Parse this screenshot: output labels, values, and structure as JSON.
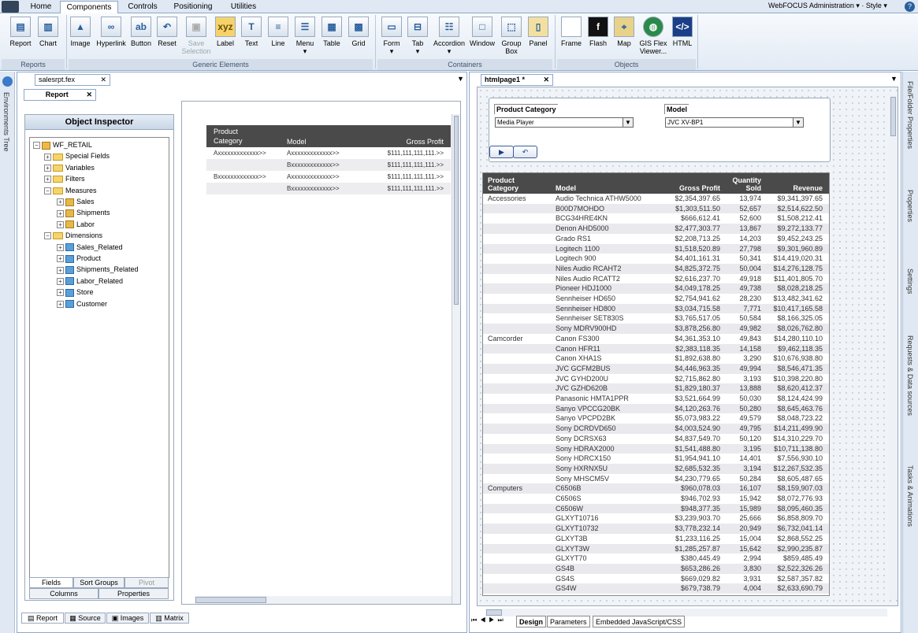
{
  "app": {
    "admin_label": "WebFOCUS Administration",
    "style_label": "Style",
    "help_label": "?"
  },
  "ribbon_tabs": [
    "Home",
    "Components",
    "Controls",
    "Positioning",
    "Utilities"
  ],
  "ribbon": {
    "reports": {
      "group": "Reports",
      "items": [
        "Report",
        "Chart"
      ]
    },
    "generic": {
      "group": "Generic Elements",
      "items": [
        "Image",
        "Hyperlink",
        "Button",
        "Reset",
        "Save Selection",
        "Label",
        "Text",
        "Line",
        "Menu",
        "Table",
        "Grid"
      ]
    },
    "containers": {
      "group": "Containers",
      "items": [
        "Form",
        "Tab",
        "Accordion",
        "Window",
        "Group Box",
        "Panel"
      ]
    },
    "objects": {
      "group": "Objects",
      "items": [
        "Frame",
        "Flash",
        "Map",
        "GIS Flex Viewer...",
        "HTML"
      ]
    }
  },
  "left_doc_tab": "salesrpt.fex",
  "left_sub_tab": "Report",
  "right_doc_tab": "htmlpage1 *",
  "object_inspector": {
    "title": "Object Inspector",
    "root": "WF_RETAIL",
    "nodes": [
      "Special Fields",
      "Variables",
      "Filters",
      "Measures",
      "Sales",
      "Shipments",
      "Labor",
      "Dimensions",
      "Sales_Related",
      "Product",
      "Shipments_Related",
      "Labor_Related",
      "Store",
      "Customer"
    ],
    "tabs_row1": [
      "Fields",
      "Sort Groups",
      "Pivot"
    ],
    "tabs_row2": [
      "Columns",
      "Properties"
    ]
  },
  "report_preview": {
    "headers": [
      "Product Category",
      "Model",
      "Gross Profit"
    ],
    "rows": [
      [
        "Axxxxxxxxxxxxx>>",
        "Axxxxxxxxxxxxx>>",
        "$111,111,111,111.>>"
      ],
      [
        "",
        "Bxxxxxxxxxxxxx>>",
        "$111,111,111,111.>>"
      ],
      [
        "Bxxxxxxxxxxxxx>>",
        "Axxxxxxxxxxxxx>>",
        "$111,111,111,111.>>"
      ],
      [
        "",
        "Bxxxxxxxxxxxxx>>",
        "$111,111,111,111.>>"
      ]
    ]
  },
  "left_bottom_tabs": [
    "Report",
    "Source",
    "Images",
    "Matrix"
  ],
  "form": {
    "category_label": "Product Category",
    "category_value": "Media Player",
    "model_label": "Model",
    "model_value": "JVC XV-BP1",
    "run_icon": "▶",
    "reset_icon": "↶"
  },
  "table": {
    "headers": [
      "Product Category",
      "Model",
      "Gross Profit",
      "Quantity Sold",
      "Revenue"
    ],
    "rows": [
      [
        "Accessories",
        "Audio Technica ATHW5000",
        "$2,354,397.65",
        "13,974",
        "$9,341,397.65"
      ],
      [
        "",
        "B00D7MOHDO",
        "$1,303,511.50",
        "52,657",
        "$2,514,622.50"
      ],
      [
        "",
        "BCG34HRE4KN",
        "$666,612.41",
        "52,600",
        "$1,508,212.41"
      ],
      [
        "",
        "Denon AHD5000",
        "$2,477,303.77",
        "13,867",
        "$9,272,133.77"
      ],
      [
        "",
        "Grado RS1",
        "$2,208,713.25",
        "14,203",
        "$9,452,243.25"
      ],
      [
        "",
        "Logitech 1100",
        "$1,518,520.89",
        "27,798",
        "$9,301,960.89"
      ],
      [
        "",
        "Logitech 900",
        "$4,401,161.31",
        "50,341",
        "$14,419,020.31"
      ],
      [
        "",
        "Niles Audio RCAHT2",
        "$4,825,372.75",
        "50,004",
        "$14,276,128.75"
      ],
      [
        "",
        "Niles Audio RCATT2",
        "$2,616,237.70",
        "49,918",
        "$11,401,805.70"
      ],
      [
        "",
        "Pioneer HDJ1000",
        "$4,049,178.25",
        "49,738",
        "$8,028,218.25"
      ],
      [
        "",
        "Sennheiser HD650",
        "$2,754,941.62",
        "28,230",
        "$13,482,341.62"
      ],
      [
        "",
        "Sennheiser HD800",
        "$3,034,715.58",
        "7,771",
        "$10,417,165.58"
      ],
      [
        "",
        "Sennheiser SET830S",
        "$3,765,517.05",
        "50,584",
        "$8,166,325.05"
      ],
      [
        "",
        "Sony MDRV900HD",
        "$3,878,256.80",
        "49,982",
        "$8,026,762.80"
      ],
      [
        "Camcorder",
        "Canon FS300",
        "$4,361,353.10",
        "49,843",
        "$14,280,110.10"
      ],
      [
        "",
        "Canon HFR11",
        "$2,383,118.35",
        "14,158",
        "$9,462,118.35"
      ],
      [
        "",
        "Canon XHA1S",
        "$1,892,638.80",
        "3,290",
        "$10,676,938.80"
      ],
      [
        "",
        "JVC GCFM2BUS",
        "$4,446,963.35",
        "49,994",
        "$8,546,471.35"
      ],
      [
        "",
        "JVC GYHD200U",
        "$2,715,862.80",
        "3,193",
        "$10,398,220.80"
      ],
      [
        "",
        "JVC GZHD620B",
        "$1,829,180.37",
        "13,888",
        "$8,620,412.37"
      ],
      [
        "",
        "Panasonic HMTA1PPR",
        "$3,521,664.99",
        "50,030",
        "$8,124,424.99"
      ],
      [
        "",
        "Sanyo VPCCG20BK",
        "$4,120,263.76",
        "50,280",
        "$8,645,463.76"
      ],
      [
        "",
        "Sanyo VPCPD2BK",
        "$5,073,983.22",
        "49,579",
        "$8,048,723.22"
      ],
      [
        "",
        "Sony DCRDVD650",
        "$4,003,524.90",
        "49,795",
        "$14,211,499.90"
      ],
      [
        "",
        "Sony DCRSX63",
        "$4,837,549.70",
        "50,120",
        "$14,310,229.70"
      ],
      [
        "",
        "Sony HDRAX2000",
        "$1,541,488.80",
        "3,195",
        "$10,711,138.80"
      ],
      [
        "",
        "Sony HDRCX150",
        "$1,954,941.10",
        "14,401",
        "$7,556,930.10"
      ],
      [
        "",
        "Sony HXRNX5U",
        "$2,685,532.35",
        "3,194",
        "$12,267,532.35"
      ],
      [
        "",
        "Sony MHSCM5V",
        "$4,230,779.65",
        "50,284",
        "$8,605,487.65"
      ],
      [
        "Computers",
        "C6506B",
        "$960,078.03",
        "16,107",
        "$8,159,907.03"
      ],
      [
        "",
        "C6506S",
        "$946,702.93",
        "15,942",
        "$8,072,776.93"
      ],
      [
        "",
        "C6506W",
        "$948,377.35",
        "15,989",
        "$8,095,460.35"
      ],
      [
        "",
        "GLXYT10716",
        "$3,239,903.70",
        "25,666",
        "$6,858,809.70"
      ],
      [
        "",
        "GLXYT10732",
        "$3,778,232.14",
        "20,949",
        "$6,732,041.14"
      ],
      [
        "",
        "GLXYT3B",
        "$1,233,116.25",
        "15,004",
        "$2,868,552.25"
      ],
      [
        "",
        "GLXYT3W",
        "$1,285,257.87",
        "15,642",
        "$2,990,235.87"
      ],
      [
        "",
        "GLXYT70",
        "$380,445.49",
        "2,994",
        "$859,485.49"
      ],
      [
        "",
        "GS4B",
        "$653,286.26",
        "3,830",
        "$2,522,326.26"
      ],
      [
        "",
        "GS4S",
        "$669,029.82",
        "3,931",
        "$2,587,357.82"
      ],
      [
        "",
        "GS4W",
        "$679,738.79",
        "4,004",
        "$2,633,690.79"
      ]
    ]
  },
  "right_bottom_tabs": [
    "Design",
    "Parameters",
    "Embedded JavaScript/CSS"
  ],
  "side_left": "Environments Tree",
  "side_right": [
    "File/Folder Properties",
    "Properties",
    "Settings",
    "Requests & Data sources",
    "Tasks & Animations"
  ]
}
